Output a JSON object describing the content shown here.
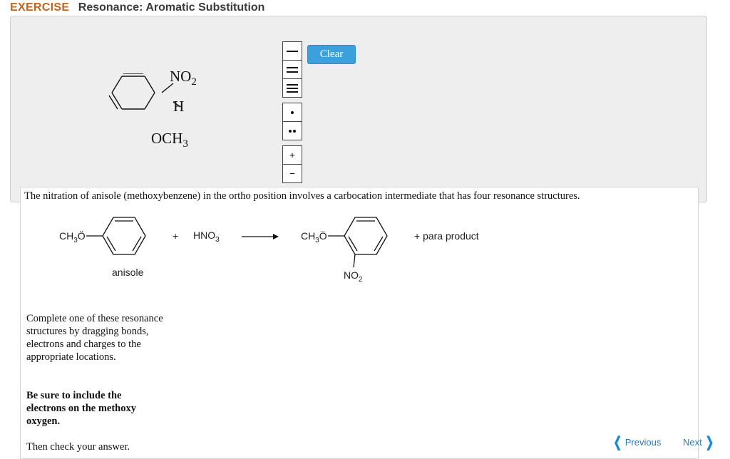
{
  "header": {
    "label": "EXERCISE",
    "title": "Resonance: Aromatic Substitution"
  },
  "canvas": {
    "no2": "NO",
    "sub2": "2",
    "h": "H",
    "och3": "OCH",
    "sub3": "3"
  },
  "toolbar": {
    "plus": "+",
    "minus": "−"
  },
  "clear_label": "Clear",
  "prompt": "The nitration of anisole (methoxybenzene) in the ortho position involves a carbocation intermediate that has four resonance structures.",
  "reaction": {
    "reactant_group": "CH",
    "reactant_sub": "3",
    "reactant_o": "Ö",
    "plus1": "+",
    "reagent": "HNO",
    "reagent_sub": "3",
    "product_group": "CH",
    "product_sub": "3",
    "product_o": "Ö",
    "plus2": "+ para product",
    "anisole_label": "anisole",
    "no2_label": "NO",
    "no2_sub": "2"
  },
  "instructions": {
    "p1": "Complete one of these resonance structures by dragging bonds, electrons and charges to the appropriate locations.",
    "p2": "Be sure to include the electrons on the methoxy oxygen.",
    "p3": "Then check your answer."
  },
  "nav": {
    "previous": "Previous",
    "next": "Next"
  }
}
